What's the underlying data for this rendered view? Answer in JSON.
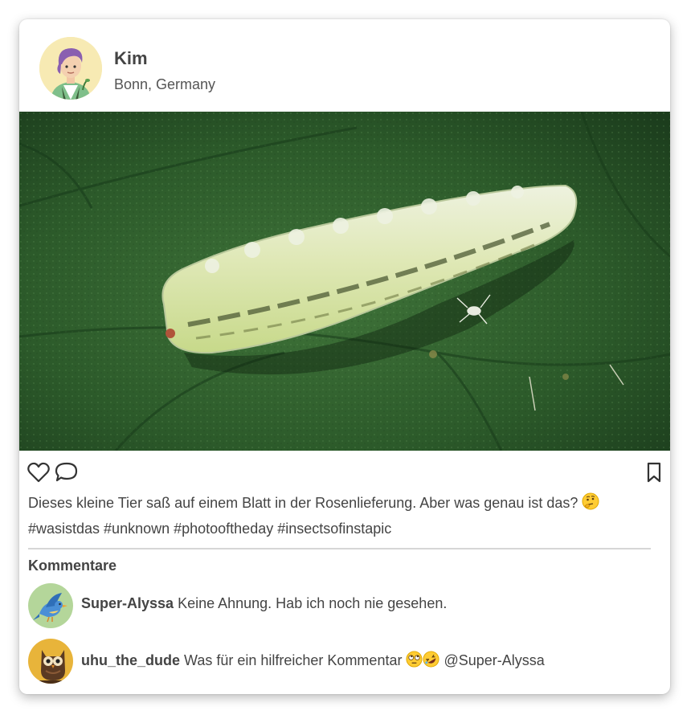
{
  "post": {
    "username": "Kim",
    "location": "Bonn, Germany",
    "caption_text": "Dieses kleine Tier saß auf einem Blatt in der Rosenlieferung. Aber was genau ist das?",
    "caption_emoji": "thinking-face",
    "hashtags": "#wasistdas #unknown #photooftheday #insectsofinstapic",
    "photo_subject": "pale green larva on a green leaf"
  },
  "actions": {
    "like_icon": "heart-icon",
    "comment_icon": "speech-bubble-icon",
    "bookmark_icon": "bookmark-icon"
  },
  "comments": {
    "title": "Kommentare",
    "items": [
      {
        "user": "Super-Alyssa",
        "text": "Keine Ahnung. Hab ich noch nie gesehen.",
        "avatar_icon": "bird-icon",
        "avatar_color": "#b4d69a"
      },
      {
        "user": "uhu_the_dude",
        "text": "Was für ein hilfreicher Kommentar",
        "emojis": [
          "eye-roll-face",
          "rolling-laughing-face"
        ],
        "mention": "@Super-Alyssa",
        "avatar_icon": "owl-icon",
        "avatar_color": "#e8b43a"
      }
    ]
  },
  "colors": {
    "text": "#444444",
    "card_background": "#ffffff",
    "divider": "#d6d6d6",
    "leaf_green": "#2f5d2c"
  }
}
